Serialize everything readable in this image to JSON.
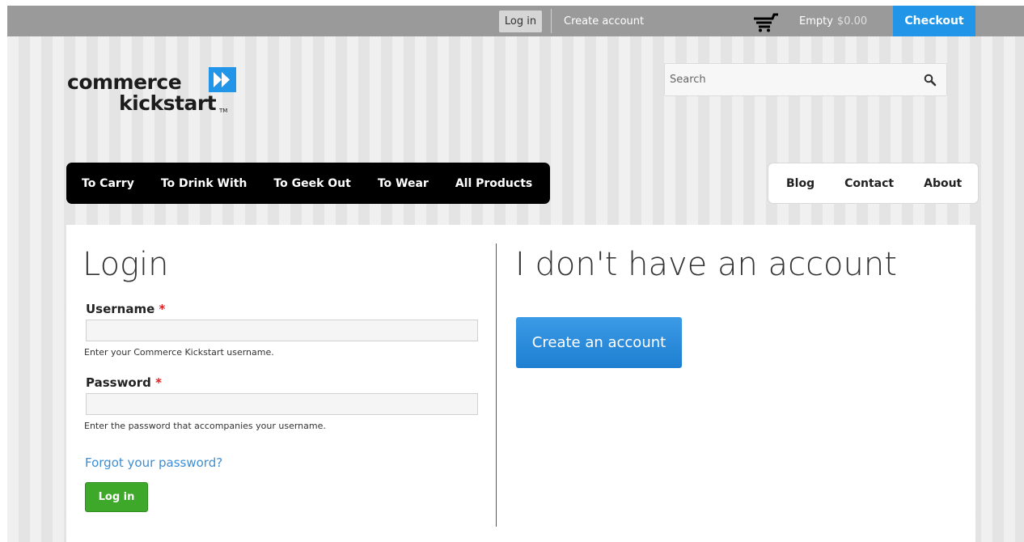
{
  "topbar": {
    "login_label": "Log in",
    "create_account_label": "Create account",
    "cart_status": "Empty",
    "cart_total": "$0.00",
    "checkout_label": "Checkout"
  },
  "logo": {
    "line1": "commerce",
    "line2": "kickstart",
    "trademark": "TM"
  },
  "search": {
    "placeholder": "Search"
  },
  "main_nav": {
    "items": [
      {
        "label": "To Carry"
      },
      {
        "label": "To Drink With"
      },
      {
        "label": "To Geek Out"
      },
      {
        "label": "To Wear"
      },
      {
        "label": "All Products"
      }
    ]
  },
  "secondary_nav": {
    "items": [
      {
        "label": "Blog"
      },
      {
        "label": "Contact"
      },
      {
        "label": "About"
      }
    ]
  },
  "login_form": {
    "title": "Login",
    "username_label": "Username",
    "username_value": "",
    "username_desc": "Enter your Commerce Kickstart username.",
    "password_label": "Password",
    "password_value": "",
    "password_desc": "Enter the password that accompanies your username.",
    "required_mark": "*",
    "forgot_link": "Forgot your password?",
    "submit_label": "Log in"
  },
  "no_account": {
    "title": "I don't have an account",
    "button_label": "Create an account"
  },
  "colors": {
    "accent_blue": "#2196e8",
    "login_green": "#3da82a",
    "required_red": "#e02020"
  }
}
